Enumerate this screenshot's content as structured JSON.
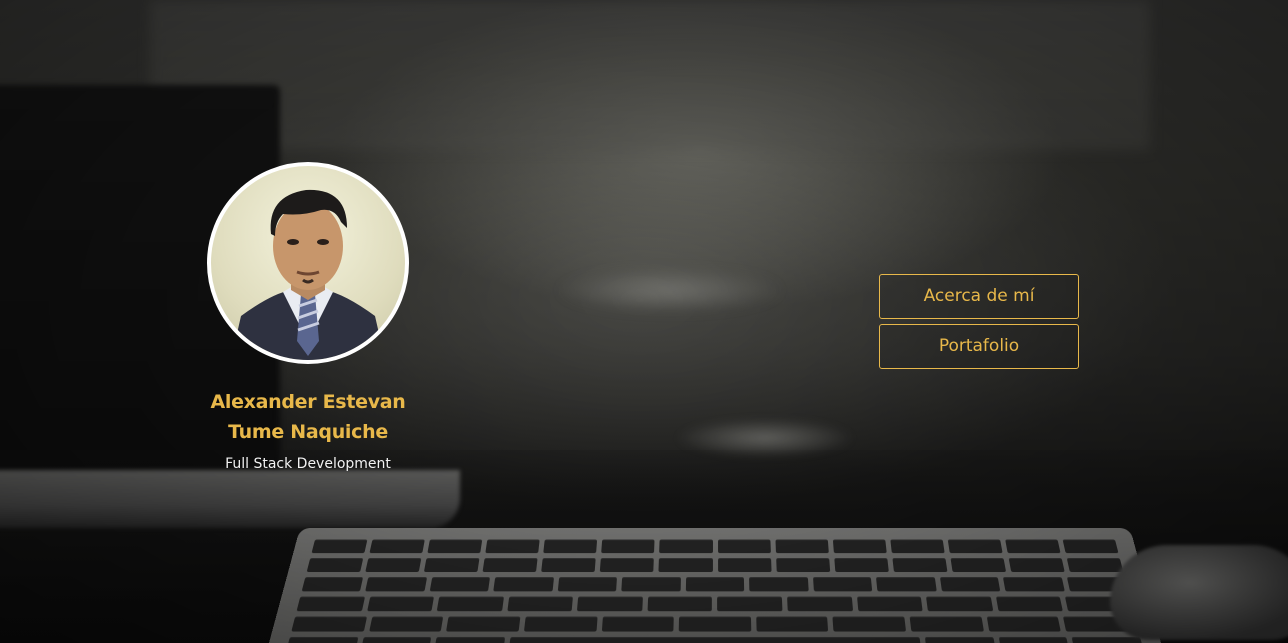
{
  "profile": {
    "name_line1": "Alexander Estevan",
    "name_line2": "Tume Naquiche",
    "role": "Full Stack Development",
    "avatar_alt": "Alexander Estevan Tume Naquiche"
  },
  "nav": {
    "about_label": "Acerca de mí",
    "portfolio_label": "Portafolio"
  },
  "colors": {
    "accent": "#e8b84a",
    "avatar_border": "#ffffff",
    "role_text": "#f2f2f2"
  }
}
